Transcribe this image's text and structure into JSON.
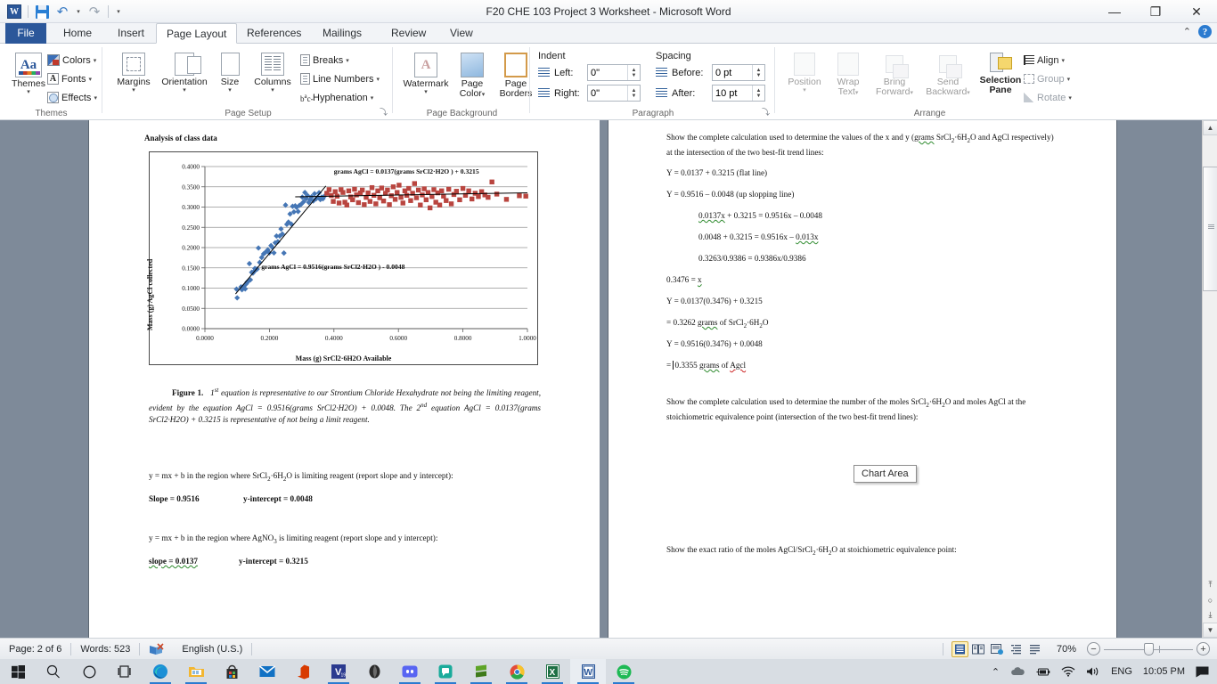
{
  "window": {
    "title": "F20 CHE 103 Project 3 Worksheet  -  Microsoft Word",
    "minimize": "—",
    "restore": "❐",
    "close": "✕",
    "help": "?",
    "ribbon_collapse": "⌃"
  },
  "qat": {
    "app_logo": "W",
    "save": "save-icon",
    "undo": "↶",
    "undo_caret": "▾",
    "redo": "↷",
    "customize_caret": "▾"
  },
  "tabs": [
    {
      "label": "File",
      "active": false
    },
    {
      "label": "Home",
      "active": false
    },
    {
      "label": "Insert",
      "active": false
    },
    {
      "label": "Page Layout",
      "active": true
    },
    {
      "label": "References",
      "active": false
    },
    {
      "label": "Mailings",
      "active": false
    },
    {
      "label": "Review",
      "active": false
    },
    {
      "label": "View",
      "active": false
    }
  ],
  "ribbon": {
    "groups": [
      {
        "name": "Themes"
      },
      {
        "name": "Page Setup"
      },
      {
        "name": "Page Background"
      },
      {
        "name": "Paragraph"
      },
      {
        "name": "Arrange"
      }
    ],
    "themes": {
      "themes_label": "Themes",
      "colors_label": "Colors",
      "fonts_label": "Fonts",
      "effects_label": "Effects",
      "aa": "Aa",
      "font_glyph": "A",
      "caret": "▾"
    },
    "page_setup": {
      "margins_label": "Margins",
      "orientation_label": "Orientation",
      "size_label": "Size",
      "columns_label": "Columns",
      "breaks_label": "Breaks",
      "line_numbers_label": "Line Numbers",
      "hyphenation_label": "Hyphenation",
      "caret": "▾",
      "dialog_launcher": "⤵"
    },
    "page_background": {
      "watermark_label": "Watermark",
      "page_color_label": "Page\nColor",
      "page_color_line1": "Page",
      "page_color_line2": "Color",
      "page_borders_line1": "Page",
      "page_borders_line2": "Borders",
      "caret": "▾"
    },
    "paragraph": {
      "indent_label": "Indent",
      "spacing_label": "Spacing",
      "left_label": "Left:",
      "right_label": "Right:",
      "before_label": "Before:",
      "after_label": "After:",
      "left_value": "0\"",
      "right_value": "0\"",
      "before_value": "0 pt",
      "after_value": "10 pt",
      "dialog_launcher": "⤵"
    },
    "arrange": {
      "position_label": "Position",
      "wrap_text_line1": "Wrap",
      "wrap_text_line2": "Text",
      "bring_forward_line1": "Bring",
      "bring_forward_line2": "Forward",
      "send_backward_line1": "Send",
      "send_backward_line2": "Backward",
      "selection_pane_line1": "Selection",
      "selection_pane_line2": "Pane",
      "align_label": "Align",
      "group_label": "Group",
      "rotate_label": "Rotate",
      "caret": "▾"
    }
  },
  "tooltip": {
    "text": "Chart Area"
  },
  "chart_data": {
    "type": "scatter",
    "title": "Analysis of class data",
    "xlabel": "Mass (g)  SrCl2·6H2O  Available",
    "ylabel": "Mass (g) AgCl collected",
    "xlim": [
      0.0,
      1.0
    ],
    "ylim": [
      0.0,
      0.4
    ],
    "xticks": [
      "0.0000",
      "0.2000",
      "0.4000",
      "0.6000",
      "0.8000",
      "1.0000"
    ],
    "yticks": [
      "0.0000",
      "0.0500",
      "0.1000",
      "0.1500",
      "0.2000",
      "0.2500",
      "0.3000",
      "0.3500",
      "0.4000"
    ],
    "grid": "horizontal",
    "legend": "none",
    "annotations": [
      {
        "text": "grams AgCl = 0.0137(grams SrCl2·H2O ) + 0.3215",
        "x": 0.4,
        "y": 0.382
      },
      {
        "text": "grams AgCl = 0.9516(grams SrCl2·H2O ) - 0.0048",
        "x": 0.175,
        "y": 0.147
      }
    ],
    "trendlines": [
      {
        "name": "up sloping (SrCl2 limiting)",
        "slope": 0.9516,
        "intercept": -0.0048,
        "x_from": 0.095,
        "x_to": 0.375,
        "color": "#000000"
      },
      {
        "name": "flat (AgNO3 limiting)",
        "slope": 0.0137,
        "intercept": 0.3215,
        "x_from": 0.28,
        "x_to": 1.0,
        "color": "#000000"
      }
    ],
    "series": [
      {
        "name": "SrCl2·6H2O limiting",
        "marker": "diamond",
        "color": "#4576b5",
        "points": [
          [
            0.098,
            0.0975
          ],
          [
            0.1,
            0.076
          ],
          [
            0.112,
            0.103
          ],
          [
            0.115,
            0.096
          ],
          [
            0.118,
            0.1025
          ],
          [
            0.122,
            0.106
          ],
          [
            0.125,
            0.098
          ],
          [
            0.128,
            0.1105
          ],
          [
            0.131,
            0.115
          ],
          [
            0.134,
            0.1165
          ],
          [
            0.138,
            0.1605
          ],
          [
            0.141,
            0.1205
          ],
          [
            0.145,
            0.139
          ],
          [
            0.149,
            0.137
          ],
          [
            0.152,
            0.141
          ],
          [
            0.155,
            0.1485
          ],
          [
            0.158,
            0.145
          ],
          [
            0.162,
            0.147
          ],
          [
            0.166,
            0.199
          ],
          [
            0.17,
            0.1635
          ],
          [
            0.176,
            0.1755
          ],
          [
            0.182,
            0.1845
          ],
          [
            0.186,
            0.187
          ],
          [
            0.19,
            0.19
          ],
          [
            0.195,
            0.1945
          ],
          [
            0.2,
            0.187
          ],
          [
            0.205,
            0.205
          ],
          [
            0.209,
            0.2005
          ],
          [
            0.214,
            0.187
          ],
          [
            0.218,
            0.212
          ],
          [
            0.222,
            0.2285
          ],
          [
            0.226,
            0.2145
          ],
          [
            0.232,
            0.2285
          ],
          [
            0.236,
            0.246
          ],
          [
            0.24,
            0.2335
          ],
          [
            0.245,
            0.1865
          ],
          [
            0.25,
            0.305
          ],
          [
            0.254,
            0.2575
          ],
          [
            0.259,
            0.263
          ],
          [
            0.264,
            0.283
          ],
          [
            0.268,
            0.258
          ],
          [
            0.272,
            0.302
          ],
          [
            0.276,
            0.288
          ],
          [
            0.28,
            0.303
          ],
          [
            0.284,
            0.2995
          ],
          [
            0.289,
            0.289
          ],
          [
            0.293,
            0.304
          ],
          [
            0.298,
            0.3065
          ],
          [
            0.302,
            0.3245
          ],
          [
            0.306,
            0.313
          ],
          [
            0.31,
            0.336
          ],
          [
            0.314,
            0.3205
          ],
          [
            0.318,
            0.3285
          ],
          [
            0.322,
            0.3115
          ],
          [
            0.326,
            0.319
          ],
          [
            0.331,
            0.3255
          ],
          [
            0.336,
            0.315
          ],
          [
            0.34,
            0.333
          ],
          [
            0.345,
            0.3205
          ],
          [
            0.35,
            0.3245
          ],
          [
            0.354,
            0.3355
          ],
          [
            0.358,
            0.3185
          ],
          [
            0.362,
            0.3245
          ],
          [
            0.366,
            0.3205
          ],
          [
            0.37,
            0.3265
          ]
        ]
      },
      {
        "name": "AgNO3 limiting",
        "marker": "square",
        "color": "#b9453f",
        "points": [
          [
            0.378,
            0.334
          ],
          [
            0.385,
            0.343
          ],
          [
            0.392,
            0.3285
          ],
          [
            0.398,
            0.314
          ],
          [
            0.404,
            0.338
          ],
          [
            0.41,
            0.327
          ],
          [
            0.416,
            0.31
          ],
          [
            0.422,
            0.343
          ],
          [
            0.428,
            0.336
          ],
          [
            0.434,
            0.312
          ],
          [
            0.44,
            0.305
          ],
          [
            0.446,
            0.34
          ],
          [
            0.452,
            0.325
          ],
          [
            0.458,
            0.318
          ],
          [
            0.464,
            0.344
          ],
          [
            0.47,
            0.33
          ],
          [
            0.476,
            0.311
          ],
          [
            0.482,
            0.335
          ],
          [
            0.488,
            0.342
          ],
          [
            0.494,
            0.306
          ],
          [
            0.5,
            0.324
          ],
          [
            0.506,
            0.335
          ],
          [
            0.512,
            0.314
          ],
          [
            0.518,
            0.348
          ],
          [
            0.524,
            0.329
          ],
          [
            0.53,
            0.308
          ],
          [
            0.536,
            0.34
          ],
          [
            0.542,
            0.323
          ],
          [
            0.548,
            0.347
          ],
          [
            0.554,
            0.315
          ],
          [
            0.56,
            0.334
          ],
          [
            0.566,
            0.342
          ],
          [
            0.572,
            0.306
          ],
          [
            0.578,
            0.328
          ],
          [
            0.584,
            0.35
          ],
          [
            0.59,
            0.319
          ],
          [
            0.596,
            0.336
          ],
          [
            0.602,
            0.354
          ],
          [
            0.608,
            0.324
          ],
          [
            0.614,
            0.31
          ],
          [
            0.62,
            0.34
          ],
          [
            0.626,
            0.329
          ],
          [
            0.632,
            0.346
          ],
          [
            0.638,
            0.316
          ],
          [
            0.644,
            0.334
          ],
          [
            0.65,
            0.358
          ],
          [
            0.656,
            0.323
          ],
          [
            0.662,
            0.342
          ],
          [
            0.668,
            0.305
          ],
          [
            0.674,
            0.33
          ],
          [
            0.68,
            0.345
          ],
          [
            0.686,
            0.318
          ],
          [
            0.692,
            0.336
          ],
          [
            0.698,
            0.298
          ],
          [
            0.704,
            0.326
          ],
          [
            0.71,
            0.343
          ],
          [
            0.716,
            0.312
          ],
          [
            0.722,
            0.335
          ],
          [
            0.728,
            0.305
          ],
          [
            0.734,
            0.34
          ],
          [
            0.74,
            0.327
          ],
          [
            0.748,
            0.316
          ],
          [
            0.756,
            0.344
          ],
          [
            0.764,
            0.308
          ],
          [
            0.772,
            0.331
          ],
          [
            0.78,
            0.339
          ],
          [
            0.79,
            0.318
          ],
          [
            0.8,
            0.346
          ],
          [
            0.808,
            0.329
          ],
          [
            0.818,
            0.34
          ],
          [
            0.828,
            0.32
          ],
          [
            0.838,
            0.334
          ],
          [
            0.848,
            0.326
          ],
          [
            0.858,
            0.338
          ],
          [
            0.868,
            0.33
          ],
          [
            0.878,
            0.324
          ],
          [
            0.89,
            0.362
          ],
          [
            0.905,
            0.332
          ],
          [
            0.935,
            0.319
          ],
          [
            0.975,
            0.328
          ],
          [
            0.995,
            0.327
          ]
        ]
      }
    ]
  },
  "document": {
    "left_page": {
      "chart_heading": "Analysis of class data",
      "figure_caption": {
        "label": "Figure 1.",
        "body": "1st equation is representative to our Strontium Chloride Hexahydrate not being the limiting reagent, evident by the equation AgCl = 0.9516(grams SrCl2·H2O) + 0.0048. The 2nd equation AgCl = 0.0137(grams SrCl2·H2O) + 0.3215 is representative of not being a limit reagent."
      },
      "q1": "y = mx + b in the region where SrCl2·6H2O is limiting reagent (report slope and y intercept):",
      "a1_slope_label": "Slope = 0.9516",
      "a1_intercept_label": "y-intercept = 0.0048",
      "q2": "y = mx + b in the region where AgNO3 is limiting reagent (report slope and y intercept):",
      "a2_slope_label": "slope = 0.0137",
      "a2_intercept_label": "y-intercept  = 0.3215"
    },
    "right_page": {
      "prompt1": "Show the complete calculation used to determine the values of the x and y (grams SrCl2·6H2O and AgCl respectively) at the intersection of the two best-fit trend lines:",
      "lines": [
        "Y = 0.0137 + 0.3215 (flat line)",
        "Y = 0.9516 – 0.0048 (up slopping line)",
        "0.0137x + 0.3215 = 0.9516x – 0.0048",
        "0.0048 + 0.3215 = 0.9516x – 0.013x",
        "0.3263/0.9386 = 0.9386x/0.9386",
        "0.3476 = x",
        "Y = 0.0137(0.3476) + 0.3215",
        "= 0.3262 grams of SrCl2·6H2O",
        "Y = 0.9516(0.3476) + 0.0048",
        "= 0.3355 grams of Agcl"
      ],
      "prompt2": "Show the complete calculation used to determine the number of the moles SrCl2·6H2O and moles AgCl at the stoichiometric equivalence point (intersection of the two best-fit trend lines):",
      "prompt3": "Show the exact ratio of the moles AgCl/SrCl2·6H2O at stoichiometric equivalence point:"
    }
  },
  "statusbar": {
    "page": "Page: 2 of 6",
    "words": "Words: 523",
    "proofing_icon": "proofing-errors-icon",
    "language": "English (U.S.)",
    "zoom_percent": "70%",
    "zoom_out": "−",
    "zoom_in": "+",
    "views": [
      {
        "name": "print-layout",
        "glyph": "☰",
        "active": true
      },
      {
        "name": "full-screen-reading",
        "glyph": "◫",
        "active": false
      },
      {
        "name": "web-layout",
        "glyph": "⊞",
        "active": false
      },
      {
        "name": "outline",
        "glyph": "≡",
        "active": false
      },
      {
        "name": "draft",
        "glyph": "☰",
        "active": false
      }
    ]
  },
  "scrollbar": {
    "up": "▲",
    "down": "▼",
    "prev_page": "⤒",
    "select_object": "○",
    "next_page": "⤓",
    "select_browse_object": "◎"
  },
  "taskbar": {
    "items": [
      {
        "name": "start-button",
        "label": "⊞",
        "color": "#1d1f22",
        "running": false
      },
      {
        "name": "search-button",
        "label": "⌕",
        "color": "#1d1f22",
        "running": false
      },
      {
        "name": "cortana-button",
        "label": "◯",
        "color": "#1d1f22",
        "running": false
      },
      {
        "name": "task-view-button",
        "label": "⌸",
        "color": "#1d1f22",
        "running": false
      },
      {
        "name": "edge-icon",
        "label": "e",
        "color": "#0f7ec8",
        "running": true
      },
      {
        "name": "file-explorer-icon",
        "label": "▤",
        "color": "#f2b632",
        "running": true
      },
      {
        "name": "microsoft-store-icon",
        "label": "▦",
        "color": "#2d2d2d",
        "running": false
      },
      {
        "name": "mail-icon",
        "label": "✉",
        "color": "#1171c4",
        "running": false
      },
      {
        "name": "office-icon",
        "label": "O",
        "color": "#d83b01",
        "running": false
      },
      {
        "name": "visual-studio-icon",
        "label": "V",
        "color": "#2b3a8f",
        "running": true
      },
      {
        "name": "blackboard-icon",
        "label": "●",
        "color": "#2b2b2b",
        "running": false
      },
      {
        "name": "discord-icon",
        "label": "◑",
        "color": "#5865f2",
        "running": true
      },
      {
        "name": "groupme-icon",
        "label": "▣",
        "color": "#1aab9b",
        "running": true
      },
      {
        "name": "sublime-text-icon",
        "label": "➤",
        "color": "#5ea427",
        "running": true
      },
      {
        "name": "chrome-icon",
        "label": "◉",
        "color": "#e24b3a",
        "running": true
      },
      {
        "name": "excel-icon",
        "label": "X",
        "color": "#1d7044",
        "running": true
      },
      {
        "name": "word-icon",
        "label": "W",
        "color": "#2b579a",
        "running": true,
        "active": true
      },
      {
        "name": "spotify-icon",
        "label": "♫",
        "color": "#1db954",
        "running": true
      }
    ],
    "tray": {
      "show_hidden": "⌃",
      "onedrive": "☁",
      "battery": "▮",
      "wifi": "◠",
      "volume": "ᵈ)",
      "language": "ENG",
      "time": "10:05 PM",
      "action_center": "▤"
    }
  }
}
